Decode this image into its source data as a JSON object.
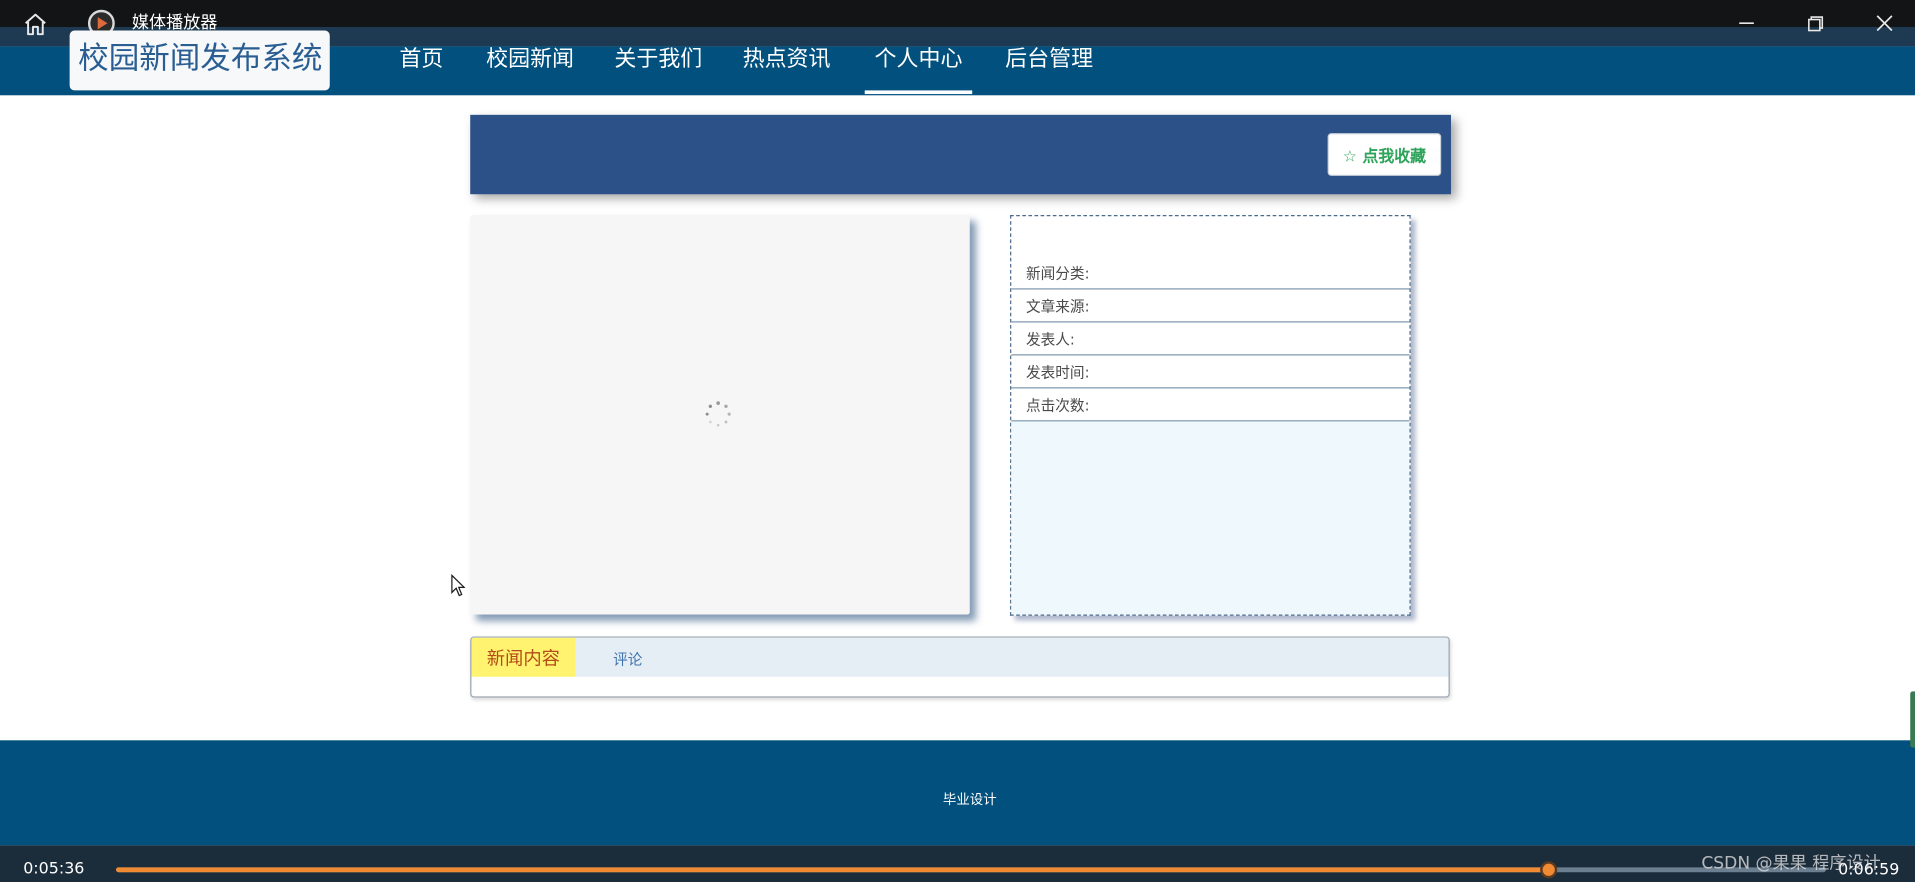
{
  "player": {
    "title": "媒体播放器",
    "current_time": "0:05:36",
    "total_time": "0:06:59",
    "progress": 0.838,
    "watermark": "CSDN @果果 程序设计"
  },
  "site": {
    "logo": "校园新闻发布系统",
    "nav": [
      {
        "label": "首页"
      },
      {
        "label": "校园新闻"
      },
      {
        "label": "关于我们"
      },
      {
        "label": "热点资讯"
      },
      {
        "label": "个人中心",
        "active": true
      },
      {
        "label": "后台管理"
      }
    ],
    "favorite_button": "☆ 点我收藏",
    "info": {
      "rows": [
        {
          "label": "新闻分类:"
        },
        {
          "label": "文章来源:"
        },
        {
          "label": "发表人:"
        },
        {
          "label": "发表时间:"
        },
        {
          "label": "点击次数:"
        }
      ]
    },
    "tabs": {
      "active": "新闻内容",
      "comment": "评论"
    },
    "footer": "毕业设计"
  },
  "colors": {
    "nav_bg": "#01507e",
    "header_band": "#2c5088",
    "favorite_text": "#2ea35a",
    "tab_active_bg": "#fff36f",
    "tab_active_text": "#b44b18",
    "progress": "#f08a33"
  },
  "icons": {
    "home": "home-icon",
    "app": "media-player-icon",
    "minimize": "minimize-icon",
    "restore": "restore-icon",
    "close": "close-icon",
    "loading": "loading-spinner-icon",
    "cursor": "mouse-cursor-icon"
  }
}
